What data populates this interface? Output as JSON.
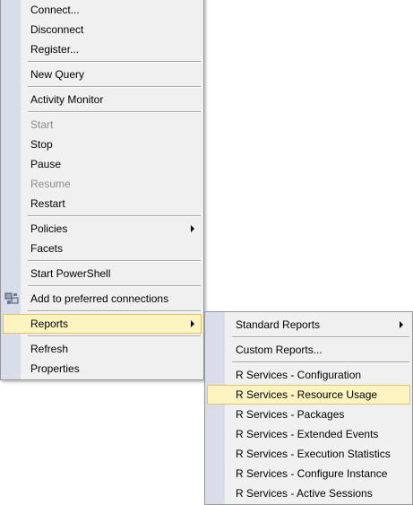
{
  "context_menu": {
    "items": [
      {
        "label": "Connect..."
      },
      {
        "label": "Disconnect"
      },
      {
        "label": "Register..."
      },
      {
        "label": "New Query"
      },
      {
        "label": "Activity Monitor"
      },
      {
        "label": "Start"
      },
      {
        "label": "Stop"
      },
      {
        "label": "Pause"
      },
      {
        "label": "Resume"
      },
      {
        "label": "Restart"
      },
      {
        "label": "Policies"
      },
      {
        "label": "Facets"
      },
      {
        "label": "Start PowerShell"
      },
      {
        "label": "Add to preferred connections"
      },
      {
        "label": "Reports"
      },
      {
        "label": "Refresh"
      },
      {
        "label": "Properties"
      }
    ]
  },
  "reports_submenu": {
    "items": [
      {
        "label": "Standard Reports"
      },
      {
        "label": "Custom Reports..."
      },
      {
        "label": "R Services - Configuration"
      },
      {
        "label": "R Services - Resource Usage"
      },
      {
        "label": "R Services - Packages"
      },
      {
        "label": "R Services - Extended Events"
      },
      {
        "label": "R Services - Execution Statistics"
      },
      {
        "label": "R Services - Configure Instance"
      },
      {
        "label": "R Services - Active Sessions"
      }
    ]
  },
  "colors": {
    "menu_background": "#f0f0f0",
    "gutter": "#d8dde9",
    "highlight": "#fcf4c0",
    "highlight_border": "#e5c365",
    "disabled_text": "#8c8c8c"
  }
}
